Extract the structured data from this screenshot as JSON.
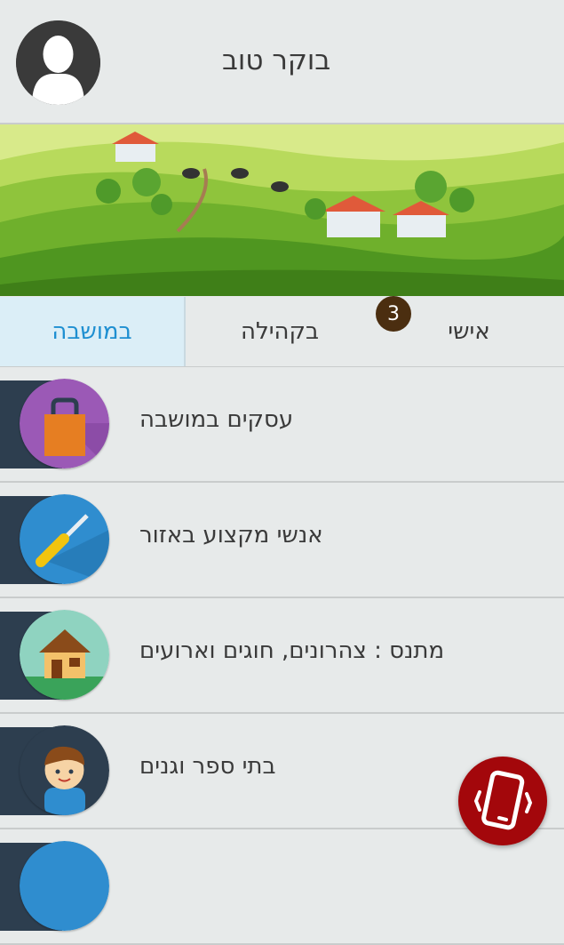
{
  "header": {
    "greeting": "בוקר טוב",
    "avatar_icon": "user-silhouette-icon"
  },
  "tabs": [
    {
      "label": "במושבה",
      "active": true
    },
    {
      "label": "בקהילה",
      "active": false
    },
    {
      "label": "אישי",
      "active": false,
      "badge": "3"
    }
  ],
  "menu": [
    {
      "label": "עסקים במושבה",
      "icon": "shopping-bag-icon",
      "icon_color": "#9b59b6"
    },
    {
      "label": "אנשי מקצוע באזור",
      "icon": "screwdriver-icon",
      "icon_color": "#2980b9"
    },
    {
      "label": "מתנס : צהרונים, חוגים וארועים",
      "icon": "house-icon",
      "icon_color": "#8fd3c0"
    },
    {
      "label": "בתי ספר וגנים",
      "icon": "child-icon",
      "icon_color": "#2d3e4f"
    }
  ],
  "fab": {
    "icon": "vibrating-phone-icon",
    "color": "#a3070b"
  },
  "colors": {
    "accent": "#1e8fd1",
    "dark_strip": "#2d3e4f",
    "badge": "#4b2e10"
  }
}
